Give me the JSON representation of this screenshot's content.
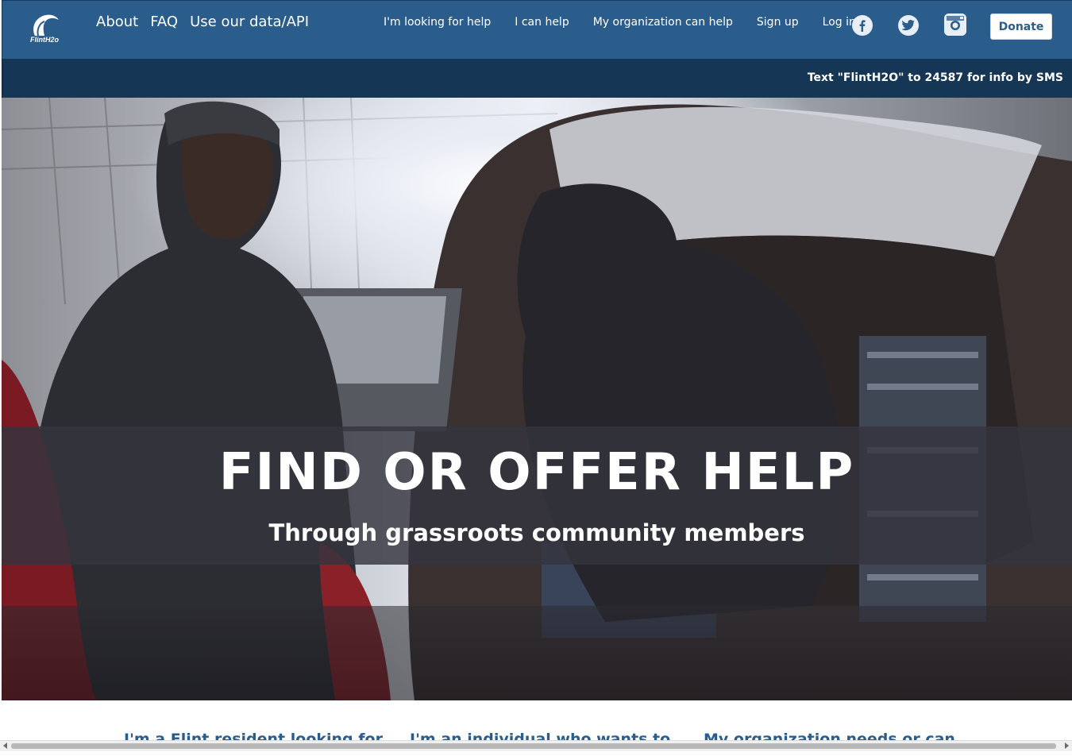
{
  "navbar": {
    "logo_text": "FlintH2o",
    "primary_links": [
      {
        "label": "About"
      },
      {
        "label": "FAQ"
      },
      {
        "label": "Use our data/API"
      }
    ],
    "secondary_links": [
      {
        "label": "I'm looking for help"
      },
      {
        "label": "I can help"
      },
      {
        "label": "My organization can help"
      },
      {
        "label": "Sign up"
      },
      {
        "label": "Log in"
      }
    ],
    "social": [
      {
        "icon": "facebook-icon"
      },
      {
        "icon": "twitter-icon"
      },
      {
        "icon": "instagram-icon"
      }
    ],
    "donate_label": "Donate"
  },
  "sms_bar": {
    "text": "Text \"FlintH2O\" to 24587 for info by SMS"
  },
  "hero": {
    "title": "FIND OR OFFER HELP",
    "subtitle": "Through grassroots community members"
  },
  "cards": [
    {
      "heading": "I'm a Flint resident looking for"
    },
    {
      "heading": "I'm an individual who wants to"
    },
    {
      "heading": "My organization needs or can"
    }
  ],
  "colors": {
    "nav_bg": "#2a5c8c",
    "sms_bg": "#163656",
    "link_blue": "#2a5c8c"
  }
}
